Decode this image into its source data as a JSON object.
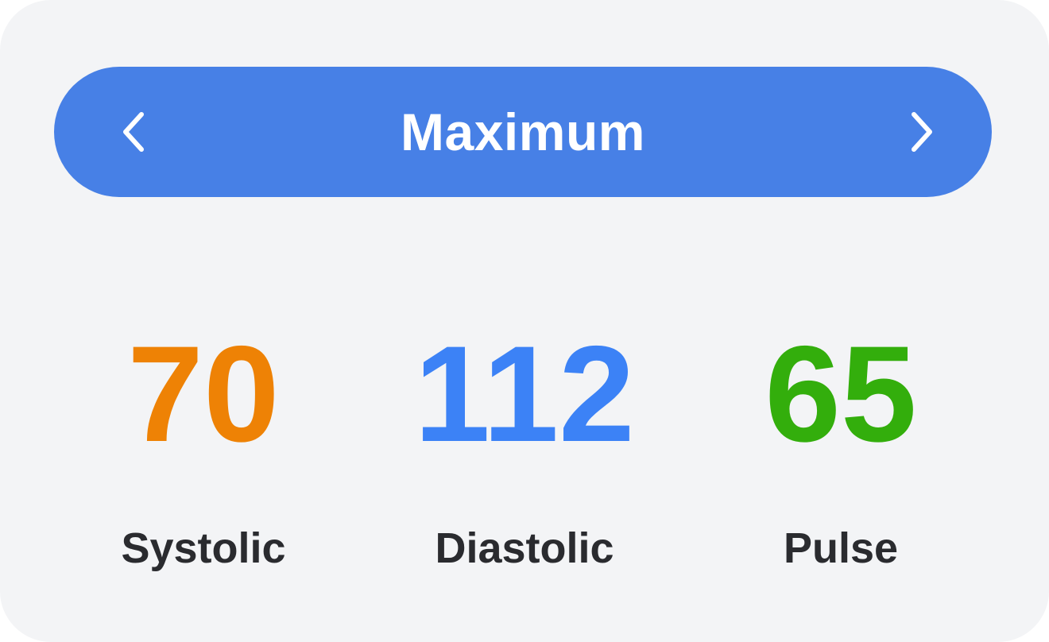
{
  "header": {
    "title": "Maximum",
    "background_color": "#4780e6",
    "prev_icon": "chevron-left-icon",
    "next_icon": "chevron-right-icon"
  },
  "stats": [
    {
      "value": "70",
      "label": "Systolic",
      "color": "#ee8205"
    },
    {
      "value": "112",
      "label": "Diastolic",
      "color": "#3c82f6"
    },
    {
      "value": "65",
      "label": "Pulse",
      "color": "#33ae0c"
    }
  ]
}
